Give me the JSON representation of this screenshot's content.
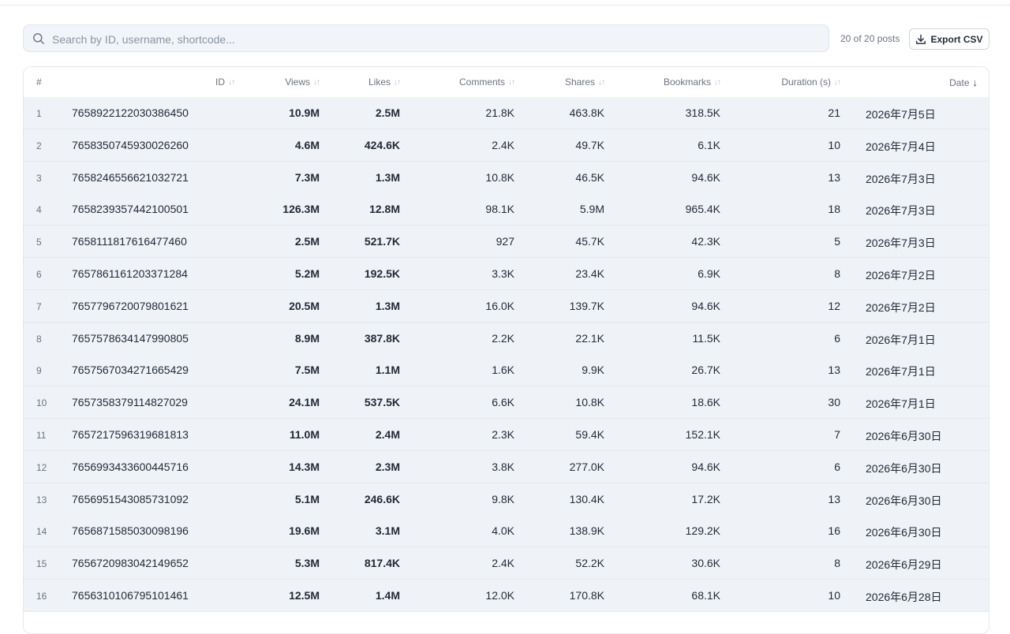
{
  "search": {
    "placeholder": "Search by ID, username, shortcode..."
  },
  "toolbar": {
    "count_text": "20 of 20 posts",
    "export_label": "Export CSV"
  },
  "table": {
    "columns": {
      "num": "#",
      "id": "ID",
      "views": "Views",
      "likes": "Likes",
      "comments": "Comments",
      "shares": "Shares",
      "bookmarks": "Bookmarks",
      "duration": "Duration (s)",
      "date": "Date"
    },
    "sort_icon": "↓↑",
    "sort_active_icon": "↓",
    "rows": [
      {
        "num": "1",
        "id": "7658922122030386450",
        "views": "10.9M",
        "likes": "2.5M",
        "comments": "21.8K",
        "shares": "463.8K",
        "bookmarks": "318.5K",
        "duration": "21",
        "date": "2026年7月5日"
      },
      {
        "num": "2",
        "id": "7658350745930026260",
        "views": "4.6M",
        "likes": "424.6K",
        "comments": "2.4K",
        "shares": "49.7K",
        "bookmarks": "6.1K",
        "duration": "10",
        "date": "2026年7月4日"
      },
      {
        "num": "3",
        "id": "7658246556621032721",
        "views": "7.3M",
        "likes": "1.3M",
        "comments": "10.8K",
        "shares": "46.5K",
        "bookmarks": "94.6K",
        "duration": "13",
        "date": "2026年7月3日"
      },
      {
        "num": "4",
        "id": "7658239357442100501",
        "views": "126.3M",
        "likes": "12.8M",
        "comments": "98.1K",
        "shares": "5.9M",
        "bookmarks": "965.4K",
        "duration": "18",
        "date": "2026年7月3日"
      },
      {
        "num": "5",
        "id": "7658111817616477460",
        "views": "2.5M",
        "likes": "521.7K",
        "comments": "927",
        "shares": "45.7K",
        "bookmarks": "42.3K",
        "duration": "5",
        "date": "2026年7月3日"
      },
      {
        "num": "6",
        "id": "7657861161203371284",
        "views": "5.2M",
        "likes": "192.5K",
        "comments": "3.3K",
        "shares": "23.4K",
        "bookmarks": "6.9K",
        "duration": "8",
        "date": "2026年7月2日"
      },
      {
        "num": "7",
        "id": "7657796720079801621",
        "views": "20.5M",
        "likes": "1.3M",
        "comments": "16.0K",
        "shares": "139.7K",
        "bookmarks": "94.6K",
        "duration": "12",
        "date": "2026年7月2日"
      },
      {
        "num": "8",
        "id": "7657578634147990805",
        "views": "8.9M",
        "likes": "387.8K",
        "comments": "2.2K",
        "shares": "22.1K",
        "bookmarks": "11.5K",
        "duration": "6",
        "date": "2026年7月1日"
      },
      {
        "num": "9",
        "id": "7657567034271665429",
        "views": "7.5M",
        "likes": "1.1M",
        "comments": "1.6K",
        "shares": "9.9K",
        "bookmarks": "26.7K",
        "duration": "13",
        "date": "2026年7月1日"
      },
      {
        "num": "10",
        "id": "7657358379114827029",
        "views": "24.1M",
        "likes": "537.5K",
        "comments": "6.6K",
        "shares": "10.8K",
        "bookmarks": "18.6K",
        "duration": "30",
        "date": "2026年7月1日"
      },
      {
        "num": "11",
        "id": "7657217596319681813",
        "views": "11.0M",
        "likes": "2.4M",
        "comments": "2.3K",
        "shares": "59.4K",
        "bookmarks": "152.1K",
        "duration": "7",
        "date": "2026年6月30日"
      },
      {
        "num": "12",
        "id": "7656993433600445716",
        "views": "14.3M",
        "likes": "2.3M",
        "comments": "3.8K",
        "shares": "277.0K",
        "bookmarks": "94.6K",
        "duration": "6",
        "date": "2026年6月30日"
      },
      {
        "num": "13",
        "id": "7656951543085731092",
        "views": "5.1M",
        "likes": "246.6K",
        "comments": "9.8K",
        "shares": "130.4K",
        "bookmarks": "17.2K",
        "duration": "13",
        "date": "2026年6月30日"
      },
      {
        "num": "14",
        "id": "7656871585030098196",
        "views": "19.6M",
        "likes": "3.1M",
        "comments": "4.0K",
        "shares": "138.9K",
        "bookmarks": "129.2K",
        "duration": "16",
        "date": "2026年6月30日"
      },
      {
        "num": "15",
        "id": "7656720983042149652",
        "views": "5.3M",
        "likes": "817.4K",
        "comments": "2.4K",
        "shares": "52.2K",
        "bookmarks": "30.6K",
        "duration": "8",
        "date": "2026年6月29日"
      },
      {
        "num": "16",
        "id": "7656310106795101461",
        "views": "12.5M",
        "likes": "1.4M",
        "comments": "12.0K",
        "shares": "170.8K",
        "bookmarks": "68.1K",
        "duration": "10",
        "date": "2026年6月28日"
      }
    ]
  }
}
